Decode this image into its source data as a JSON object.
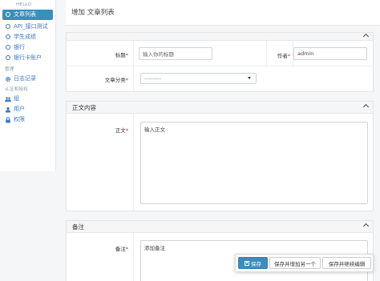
{
  "sidebar": {
    "section_hello": "HELLO",
    "items_top": [
      {
        "label": "文章列表",
        "icon": "circle-icon",
        "active": true
      },
      {
        "label": "API_接口测试",
        "icon": "circle-icon",
        "active": false
      },
      {
        "label": "学生成绩",
        "icon": "circle-icon",
        "active": false
      },
      {
        "label": "银行",
        "icon": "circle-icon",
        "active": false
      },
      {
        "label": "银行卡账户",
        "icon": "circle-icon",
        "active": false
      }
    ],
    "section_manage": "管理",
    "log_label": "日志记录",
    "section_auth": "认证和授权",
    "group_label": "组",
    "user_label": "用户",
    "perm_label": "权限"
  },
  "header": {
    "title": "增加 文章列表"
  },
  "form": {
    "title_label": "标题",
    "title_placeholder": "输入你的标题",
    "author_label": "作者",
    "author_value": "admin",
    "category_label": "文章分类",
    "category_value": "---------",
    "required_mark": "*"
  },
  "content_panel": {
    "heading": "正文内容",
    "body_label": "正文",
    "body_placeholder": "输入正文"
  },
  "notes_panel": {
    "heading": "备注",
    "notes_label": "备注",
    "notes_placeholder": "添加备注"
  },
  "actions": {
    "save": "保存",
    "save_add_another": "保存并增加另一个",
    "save_continue": "保存并继续编辑"
  },
  "colors": {
    "accent": "#3c8dbc",
    "link": "#3c78c2",
    "required": "#c9302c"
  }
}
